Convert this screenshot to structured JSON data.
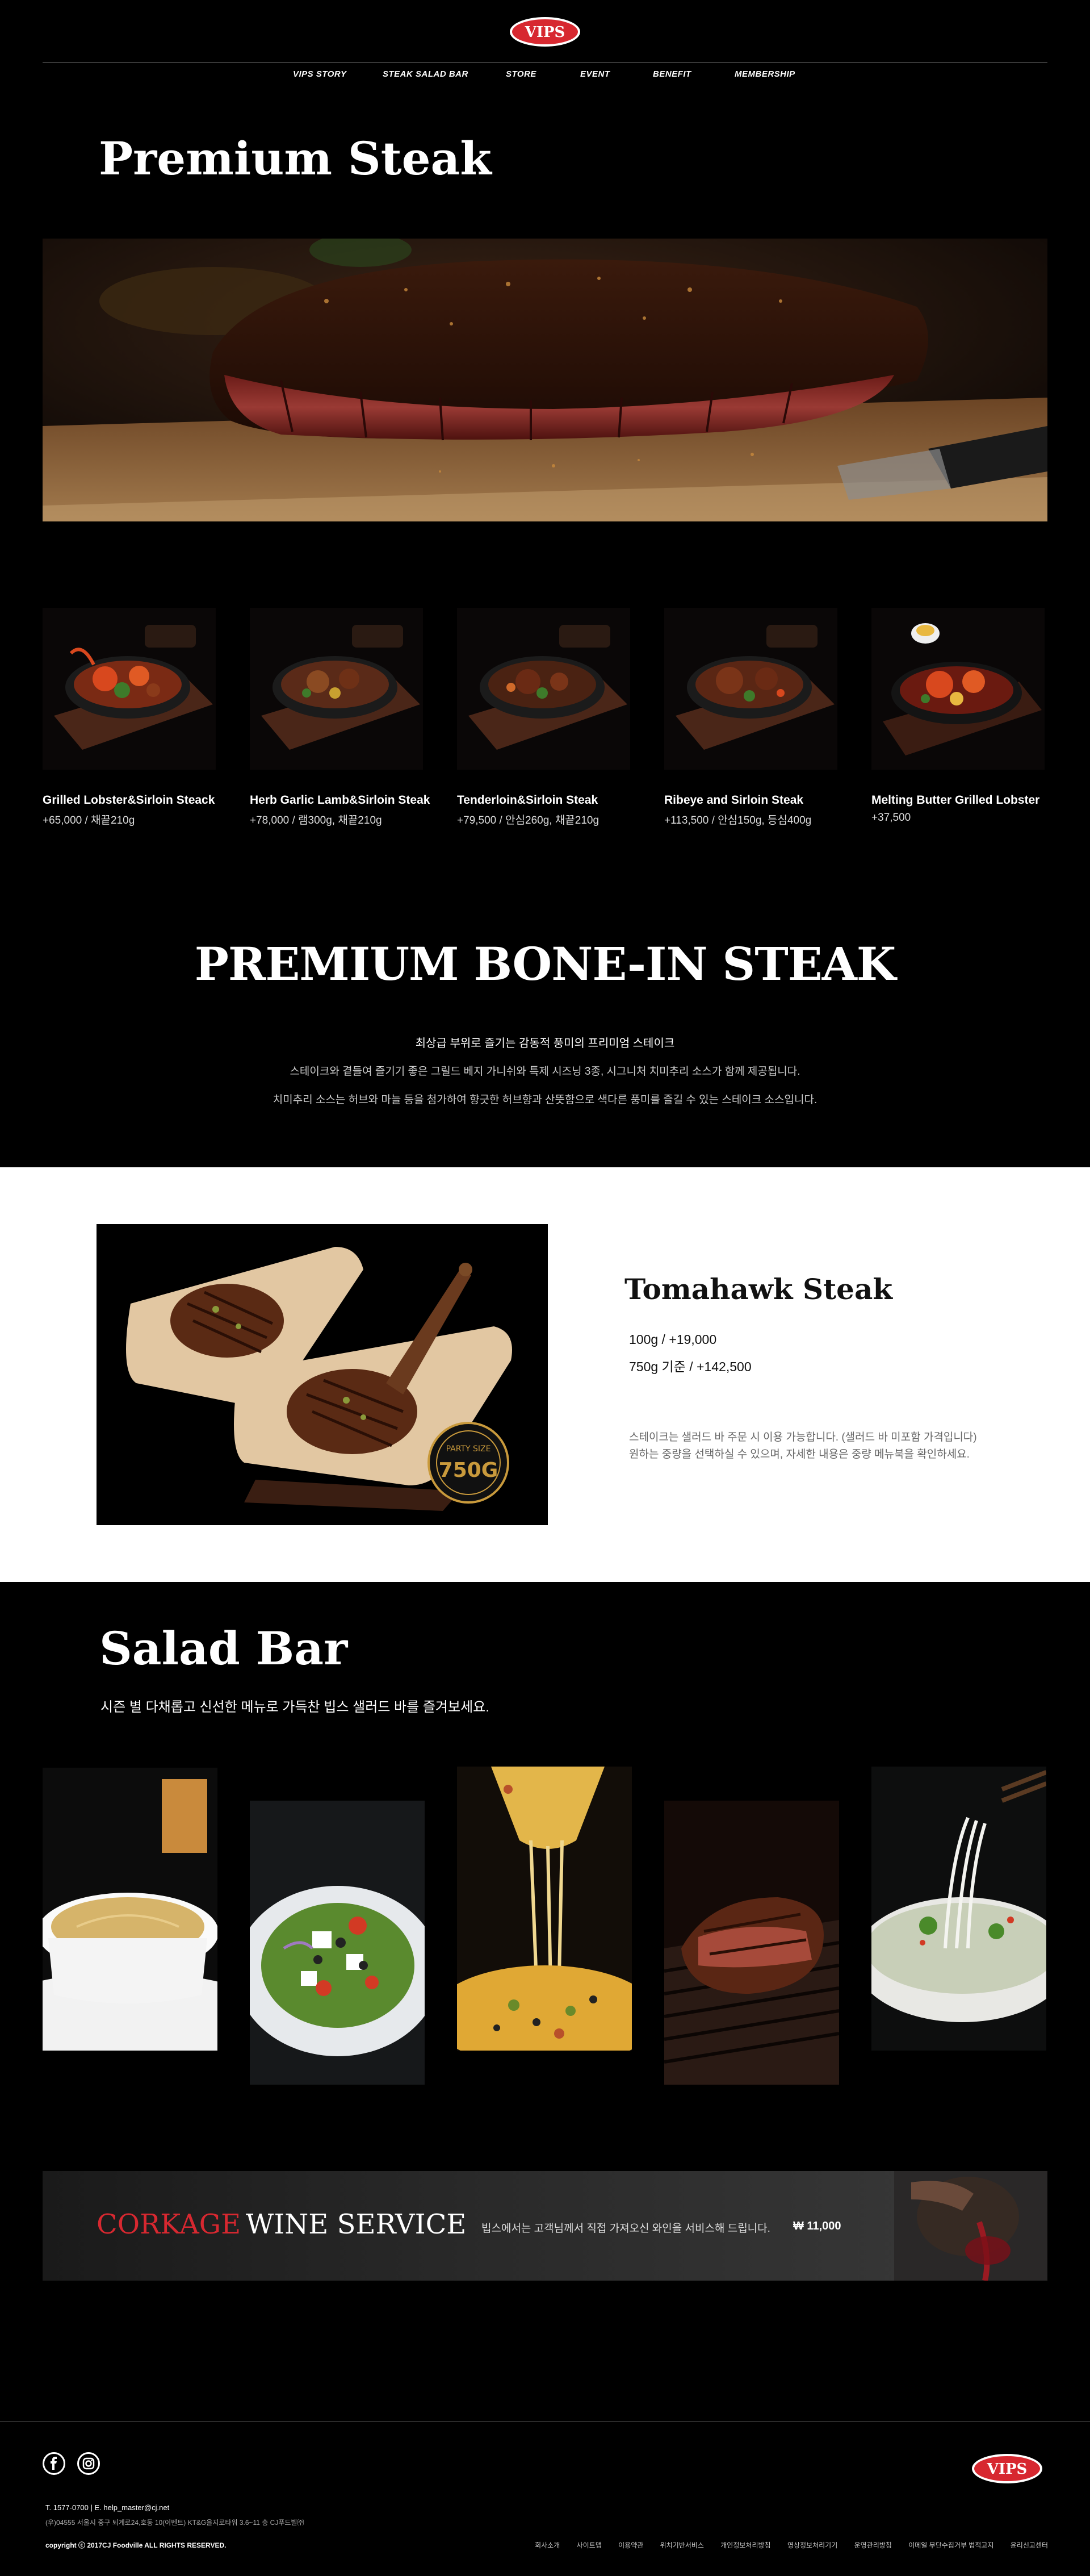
{
  "brand": {
    "logo_text": "VIPS",
    "accent": "#d72830"
  },
  "nav": {
    "items": [
      {
        "label": "VIPS STORY"
      },
      {
        "label": "STEAK SALAD BAR"
      },
      {
        "label": "STORE"
      },
      {
        "label": "EVENT"
      },
      {
        "label": "BENEFIT"
      },
      {
        "label": "MEMBERSHIP"
      }
    ]
  },
  "premium": {
    "title": "Premium Steak"
  },
  "menu": [
    {
      "name": "Grilled Lobster&Sirloin Steack",
      "price": "+65,000 / 채끝210g"
    },
    {
      "name": "Herb Garlic Lamb&Sirloin Steak",
      "price": "+78,000 / 램300g, 채끝210g"
    },
    {
      "name": "Tenderloin&Sirloin Steak",
      "price": "+79,500 / 안심260g, 채끝210g"
    },
    {
      "name": "Ribeye and Sirloin Steak",
      "price": "+113,500 / 안심150g, 등심400g"
    },
    {
      "name": "Melting Butter Grilled Lobster",
      "price": "+37,500"
    }
  ],
  "bonein": {
    "title": "PREMIUM BONE-IN STEAK",
    "lines": [
      "최상급 부위로 즐기는 감동적 풍미의 프리미엄 스테이크",
      "스테이크와 곁들여 즐기기 좋은 그릴드 베지 가니쉬와 특제 시즈닝 3종, 시그니처 치미추리 소스가 함께 제공됩니다.",
      "치미추리 소스는 허브와 마늘 등을 첨가하여 향긋한 허브향과 산뜻함으로 색다른 풍미를 즐길 수 있는 스테이크 소스입니다."
    ]
  },
  "tomahawk": {
    "title": "Tomahawk Steak",
    "price_1": "100g  / +19,000",
    "price_2": "750g 기준 /  +142,500",
    "desc_1": "스테이크는 샐러드 바 주문 시 이용 가능합니다. (샐러드 바 미포함 가격입니다)",
    "desc_2": "원하는 중량을 선택하실 수 있으며, 자세한 내용은 중량 메뉴북을 확인하세요.",
    "badge_1": "PARTY SIZE",
    "badge_2": "750G"
  },
  "salad": {
    "title": "Salad Bar",
    "subtitle": "시즌 별 다채롭고 신선한 메뉴로 가득찬 빕스 샐러드 바를 즐겨보세요."
  },
  "corkage": {
    "title_red": "CORKAGE",
    "title_white": "WINE SERVICE",
    "desc": "빕스에서는 고객님께서 직접 가져오신 와인을 서비스해 드립니다.",
    "price": "₩ 11,000"
  },
  "footer": {
    "contact": "T. 1577-0700    |    E. help_master@cj.net",
    "address": "(우)04555 서울시 중구 퇴계로24,호동 10(이벤트) KT&G을지로타워 3.6~11 층 CJ푸드빌㈜",
    "copyright": "copyright ⓒ 2017CJ Foodville ALL RIGHTS RESERVED.",
    "links": [
      "회사소개",
      "사이트맵",
      "이용약관",
      "위치기반서비스",
      "개인정보처리방침",
      "영상정보처리기기",
      "운영관리방침",
      "이메일 무단수집거부 법적고지",
      "윤리신고센터"
    ]
  }
}
